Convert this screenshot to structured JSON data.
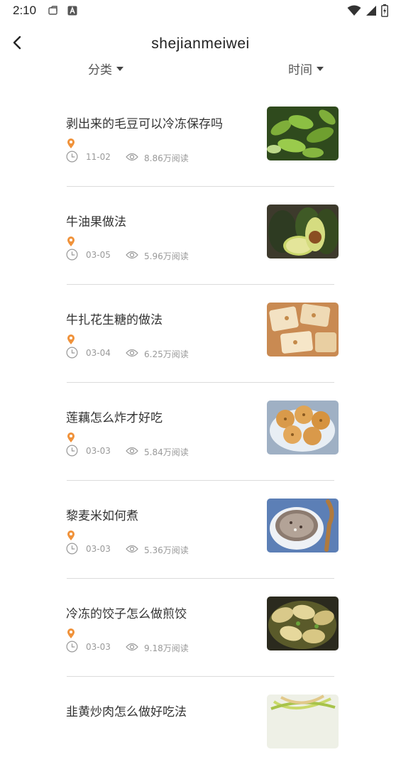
{
  "status": {
    "time": "2:10"
  },
  "header": {
    "title": "shejianmeiwei"
  },
  "filters": {
    "category": "分类",
    "time": "时间"
  },
  "colors": {
    "accent": "#f0923a",
    "meta": "#999999"
  },
  "items": [
    {
      "title": "剥出来的毛豆可以冷冻保存吗",
      "date": "11-02",
      "reads": "8.86万阅读",
      "image": "edamame"
    },
    {
      "title": "牛油果做法",
      "date": "03-05",
      "reads": "5.96万阅读",
      "image": "avocado"
    },
    {
      "title": "牛扎花生糖的做法",
      "date": "03-04",
      "reads": "6.25万阅读",
      "image": "nougat"
    },
    {
      "title": "莲藕怎么炸才好吃",
      "date": "03-03",
      "reads": "5.84万阅读",
      "image": "fried-lotus-root"
    },
    {
      "title": "黎麦米如何煮",
      "date": "03-03",
      "reads": "5.36万阅读",
      "image": "quinoa"
    },
    {
      "title": "冷冻的饺子怎么做煎饺",
      "date": "03-03",
      "reads": "9.18万阅读",
      "image": "fried-dumplings"
    },
    {
      "title": "韭黄炒肉怎么做好吃法",
      "date": "",
      "reads": "",
      "image": "stir-fry"
    }
  ]
}
